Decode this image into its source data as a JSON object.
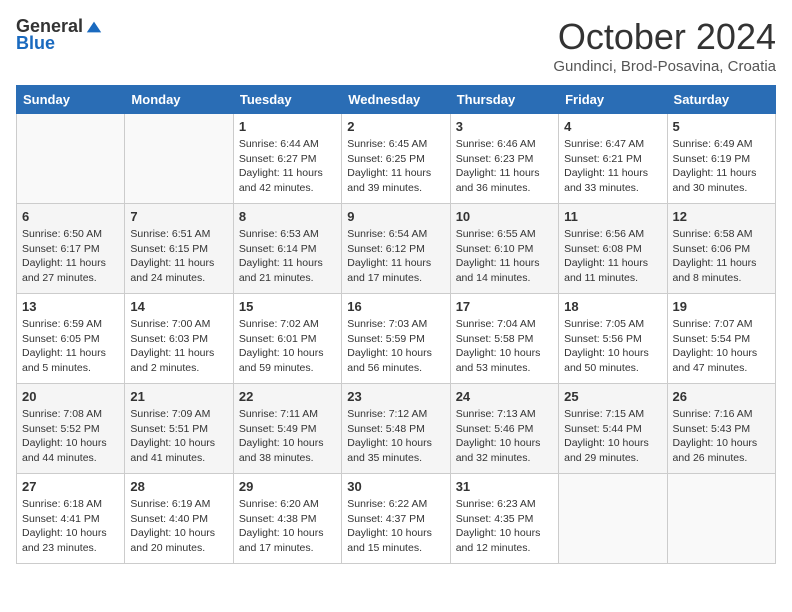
{
  "header": {
    "logo_general": "General",
    "logo_blue": "Blue",
    "month_title": "October 2024",
    "subtitle": "Gundinci, Brod-Posavina, Croatia"
  },
  "days_of_week": [
    "Sunday",
    "Monday",
    "Tuesday",
    "Wednesday",
    "Thursday",
    "Friday",
    "Saturday"
  ],
  "weeks": [
    [
      {
        "day": "",
        "info": ""
      },
      {
        "day": "",
        "info": ""
      },
      {
        "day": "1",
        "info": "Sunrise: 6:44 AM\nSunset: 6:27 PM\nDaylight: 11 hours and 42 minutes."
      },
      {
        "day": "2",
        "info": "Sunrise: 6:45 AM\nSunset: 6:25 PM\nDaylight: 11 hours and 39 minutes."
      },
      {
        "day": "3",
        "info": "Sunrise: 6:46 AM\nSunset: 6:23 PM\nDaylight: 11 hours and 36 minutes."
      },
      {
        "day": "4",
        "info": "Sunrise: 6:47 AM\nSunset: 6:21 PM\nDaylight: 11 hours and 33 minutes."
      },
      {
        "day": "5",
        "info": "Sunrise: 6:49 AM\nSunset: 6:19 PM\nDaylight: 11 hours and 30 minutes."
      }
    ],
    [
      {
        "day": "6",
        "info": "Sunrise: 6:50 AM\nSunset: 6:17 PM\nDaylight: 11 hours and 27 minutes."
      },
      {
        "day": "7",
        "info": "Sunrise: 6:51 AM\nSunset: 6:15 PM\nDaylight: 11 hours and 24 minutes."
      },
      {
        "day": "8",
        "info": "Sunrise: 6:53 AM\nSunset: 6:14 PM\nDaylight: 11 hours and 21 minutes."
      },
      {
        "day": "9",
        "info": "Sunrise: 6:54 AM\nSunset: 6:12 PM\nDaylight: 11 hours and 17 minutes."
      },
      {
        "day": "10",
        "info": "Sunrise: 6:55 AM\nSunset: 6:10 PM\nDaylight: 11 hours and 14 minutes."
      },
      {
        "day": "11",
        "info": "Sunrise: 6:56 AM\nSunset: 6:08 PM\nDaylight: 11 hours and 11 minutes."
      },
      {
        "day": "12",
        "info": "Sunrise: 6:58 AM\nSunset: 6:06 PM\nDaylight: 11 hours and 8 minutes."
      }
    ],
    [
      {
        "day": "13",
        "info": "Sunrise: 6:59 AM\nSunset: 6:05 PM\nDaylight: 11 hours and 5 minutes."
      },
      {
        "day": "14",
        "info": "Sunrise: 7:00 AM\nSunset: 6:03 PM\nDaylight: 11 hours and 2 minutes."
      },
      {
        "day": "15",
        "info": "Sunrise: 7:02 AM\nSunset: 6:01 PM\nDaylight: 10 hours and 59 minutes."
      },
      {
        "day": "16",
        "info": "Sunrise: 7:03 AM\nSunset: 5:59 PM\nDaylight: 10 hours and 56 minutes."
      },
      {
        "day": "17",
        "info": "Sunrise: 7:04 AM\nSunset: 5:58 PM\nDaylight: 10 hours and 53 minutes."
      },
      {
        "day": "18",
        "info": "Sunrise: 7:05 AM\nSunset: 5:56 PM\nDaylight: 10 hours and 50 minutes."
      },
      {
        "day": "19",
        "info": "Sunrise: 7:07 AM\nSunset: 5:54 PM\nDaylight: 10 hours and 47 minutes."
      }
    ],
    [
      {
        "day": "20",
        "info": "Sunrise: 7:08 AM\nSunset: 5:52 PM\nDaylight: 10 hours and 44 minutes."
      },
      {
        "day": "21",
        "info": "Sunrise: 7:09 AM\nSunset: 5:51 PM\nDaylight: 10 hours and 41 minutes."
      },
      {
        "day": "22",
        "info": "Sunrise: 7:11 AM\nSunset: 5:49 PM\nDaylight: 10 hours and 38 minutes."
      },
      {
        "day": "23",
        "info": "Sunrise: 7:12 AM\nSunset: 5:48 PM\nDaylight: 10 hours and 35 minutes."
      },
      {
        "day": "24",
        "info": "Sunrise: 7:13 AM\nSunset: 5:46 PM\nDaylight: 10 hours and 32 minutes."
      },
      {
        "day": "25",
        "info": "Sunrise: 7:15 AM\nSunset: 5:44 PM\nDaylight: 10 hours and 29 minutes."
      },
      {
        "day": "26",
        "info": "Sunrise: 7:16 AM\nSunset: 5:43 PM\nDaylight: 10 hours and 26 minutes."
      }
    ],
    [
      {
        "day": "27",
        "info": "Sunrise: 6:18 AM\nSunset: 4:41 PM\nDaylight: 10 hours and 23 minutes."
      },
      {
        "day": "28",
        "info": "Sunrise: 6:19 AM\nSunset: 4:40 PM\nDaylight: 10 hours and 20 minutes."
      },
      {
        "day": "29",
        "info": "Sunrise: 6:20 AM\nSunset: 4:38 PM\nDaylight: 10 hours and 17 minutes."
      },
      {
        "day": "30",
        "info": "Sunrise: 6:22 AM\nSunset: 4:37 PM\nDaylight: 10 hours and 15 minutes."
      },
      {
        "day": "31",
        "info": "Sunrise: 6:23 AM\nSunset: 4:35 PM\nDaylight: 10 hours and 12 minutes."
      },
      {
        "day": "",
        "info": ""
      },
      {
        "day": "",
        "info": ""
      }
    ]
  ]
}
